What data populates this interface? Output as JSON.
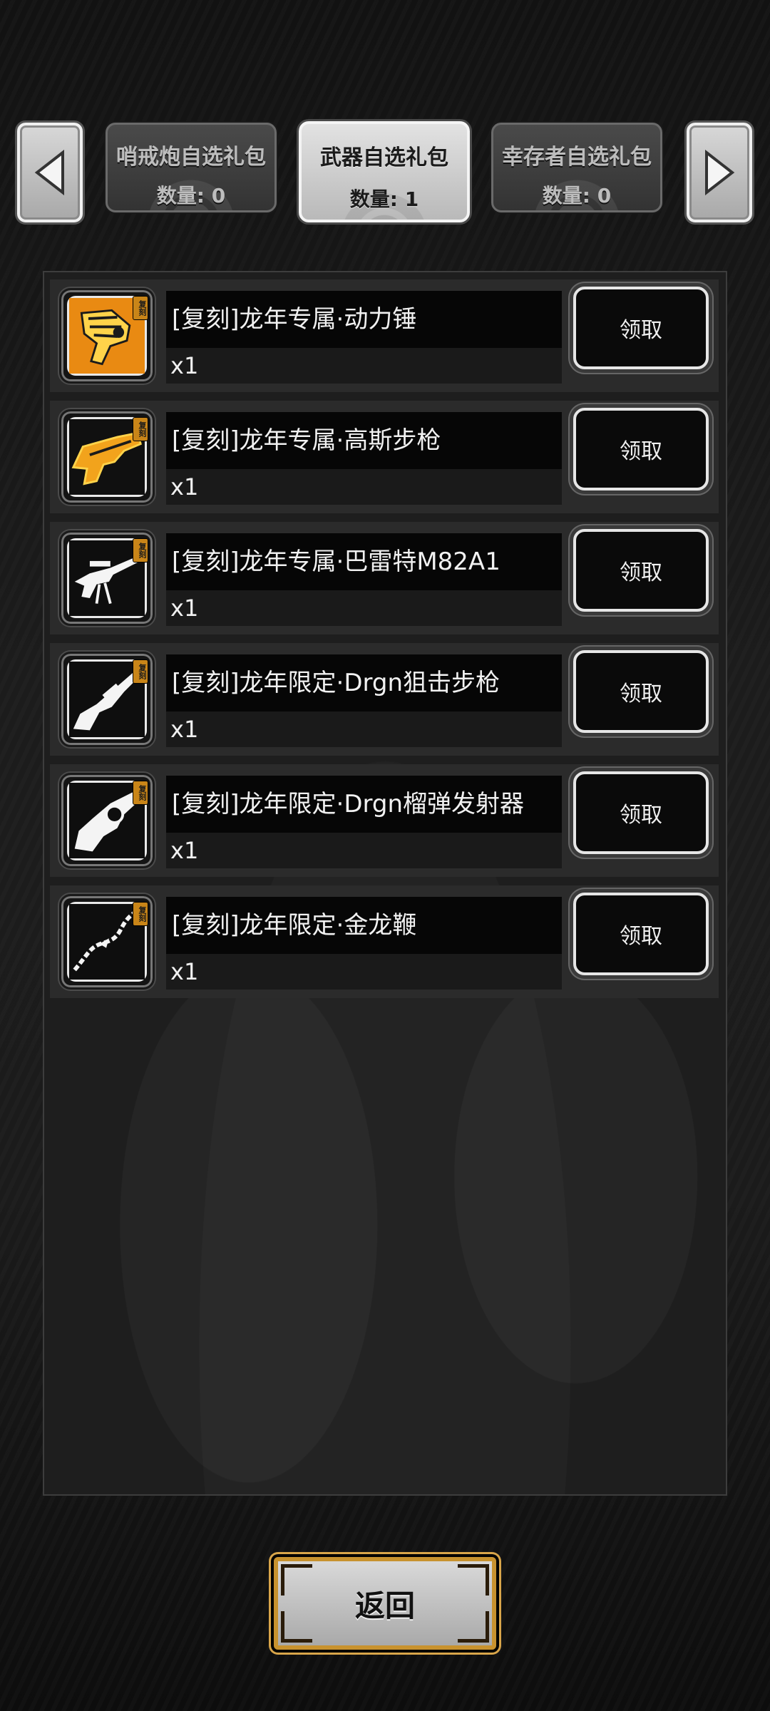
{
  "tabs": [
    {
      "title": "哨戒炮自选礼包",
      "count": "数量: 0",
      "active": false
    },
    {
      "title": "武器自选礼包",
      "count": "数量: 1",
      "active": true
    },
    {
      "title": "幸存者自选礼包",
      "count": "数量: 0",
      "active": false
    }
  ],
  "nav": {
    "prev_icon": "triangle-left-icon",
    "next_icon": "triangle-right-icon"
  },
  "items": [
    {
      "name": "[复刻]龙年专属·动力锤",
      "qty": "x1",
      "badge": "复刻",
      "icon": "power-hammer-icon",
      "claim": "领取",
      "color": "#f2a31c"
    },
    {
      "name": "[复刻]龙年专属·高斯步枪",
      "qty": "x1",
      "badge": "复刻",
      "icon": "gauss-rifle-icon",
      "claim": "领取",
      "color": "#f2a31c"
    },
    {
      "name": "[复刻]龙年专属·巴雷特M82A1",
      "qty": "x1",
      "badge": "复刻",
      "icon": "barrett-rifle-icon",
      "claim": "领取",
      "color": "#ffffff"
    },
    {
      "name": "[复刻]龙年限定·Drgn狙击步枪",
      "qty": "x1",
      "badge": "复刻",
      "icon": "sniper-rifle-icon",
      "claim": "领取",
      "color": "#ffffff"
    },
    {
      "name": "[复刻]龙年限定·Drgn榴弹发射器",
      "qty": "x1",
      "badge": "复刻",
      "icon": "grenade-launcher-icon",
      "claim": "领取",
      "color": "#ffffff"
    },
    {
      "name": "[复刻]龙年限定·金龙鞭",
      "qty": "x1",
      "badge": "复刻",
      "icon": "dragon-whip-icon",
      "claim": "领取",
      "color": "#ffffff"
    }
  ],
  "back_button": {
    "label": "返回"
  },
  "colors": {
    "accent_gold": "#c8922e",
    "badge": "#c98518",
    "background": "#1b1b1b"
  }
}
